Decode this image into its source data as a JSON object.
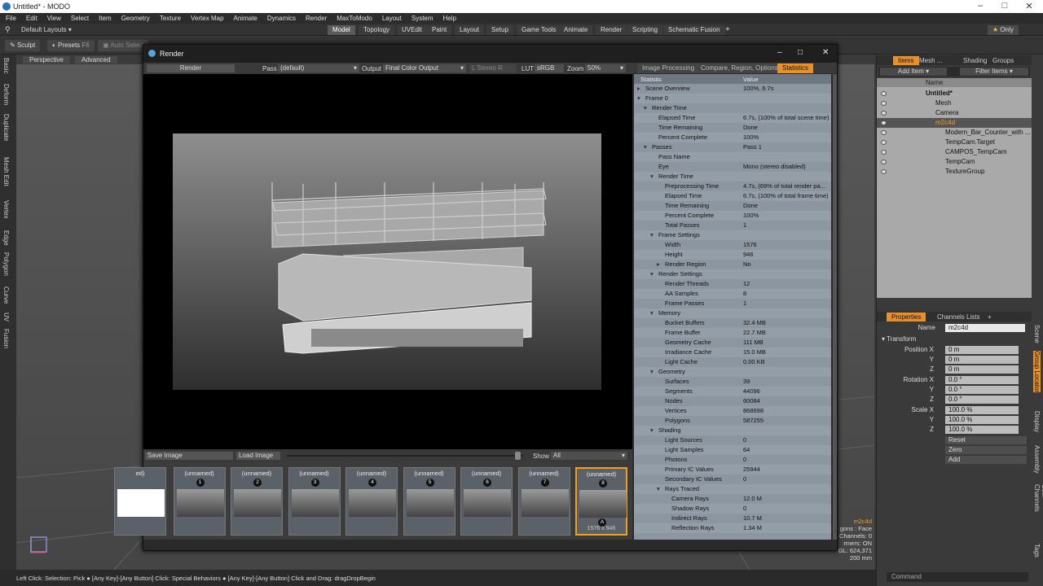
{
  "app": {
    "title": "Untitled* - MODO"
  },
  "menu": [
    "File",
    "Edit",
    "View",
    "Select",
    "Item",
    "Geometry",
    "Texture",
    "Vertex Map",
    "Animate",
    "Dynamics",
    "Render",
    "MaxToModo",
    "Layout",
    "System",
    "Help"
  ],
  "layouts": {
    "label": "Default Layouts",
    "tabs": [
      "Model",
      "Topology",
      "UVEdit",
      "Paint",
      "Layout",
      "Setup",
      "Game Tools",
      "Animate",
      "Render",
      "Scripting",
      "Schematic Fusion"
    ],
    "plus": "+",
    "only": "Only"
  },
  "toolbar": {
    "sculpt": "Sculpt",
    "presets": "Presets",
    "presets_key": "F6",
    "auto_select": "Auto Select"
  },
  "leftstrip": [
    "Basic",
    "Deform",
    "Duplicate",
    "Mesh Edit",
    "Vertex",
    "Edge",
    "Polygon",
    "Curve",
    "UV",
    "Fusion"
  ],
  "viewport": {
    "perspective": "Perspective",
    "advanced": "Advanced"
  },
  "status": "Left Click: Selection: Pick ● [Any Key]-[Any Button] Click: Special Behaviors ● [Any Key]-[Any Button] Click and Drag: dragDropBegin",
  "info": {
    "name": "m2c4d",
    "line1": "gons : Face",
    "line2": "Channels: 0",
    "line3": "rmers: ON",
    "line4": "GL: 624,371",
    "line5": "200 mm"
  },
  "render": {
    "title": "Render",
    "render_btn": "Render",
    "pass_label": "Pass",
    "pass_value": "(default)",
    "output_label": "Output",
    "output_value": "Final Color Output",
    "stereo": "Stereo",
    "stereo_key": "R",
    "lut_label": "LUT",
    "lut_value": "sRGB",
    "zoom_label": "Zoom",
    "zoom_value": "50%",
    "save_image": "Save Image",
    "load_image": "Load Image",
    "show_label": "Show",
    "show_value": "All",
    "tabs": [
      "Image Processing",
      "Compare, Region, Options",
      "Statistics"
    ],
    "thumbs": [
      {
        "label": "ed)",
        "num": ""
      },
      {
        "label": "(unnamed)",
        "num": "1"
      },
      {
        "label": "(unnamed)",
        "num": "2"
      },
      {
        "label": "(unnamed)",
        "num": "3"
      },
      {
        "label": "(unnamed)",
        "num": "4"
      },
      {
        "label": "(unnamed)",
        "num": "5"
      },
      {
        "label": "(unnamed)",
        "num": "6"
      },
      {
        "label": "(unnamed)",
        "num": "7"
      },
      {
        "label": "(unnamed)",
        "num": "8",
        "size": "1576 x 946",
        "marker": "A"
      }
    ],
    "stats_head": {
      "k": "Statistic",
      "v": "Value"
    },
    "stats": [
      {
        "k": "Scene Overview",
        "v": "100%, 6.7s",
        "d": 0,
        "a": "▸"
      },
      {
        "k": "Frame 0",
        "v": "",
        "d": 0,
        "a": "▾"
      },
      {
        "k": "Render Time",
        "v": "",
        "d": 1,
        "a": "▾"
      },
      {
        "k": "Elapsed Time",
        "v": "6.7s, (100% of total scene time)",
        "d": 2,
        "a": ""
      },
      {
        "k": "Time Remaining",
        "v": "Done",
        "d": 2,
        "a": ""
      },
      {
        "k": "Percent Complete",
        "v": "100%",
        "d": 2,
        "a": ""
      },
      {
        "k": "Passes",
        "v": "Pass 1",
        "d": 1,
        "a": "▾"
      },
      {
        "k": "Pass Name",
        "v": "",
        "d": 2,
        "a": ""
      },
      {
        "k": "Eye",
        "v": "Mono (stereo disabled)",
        "d": 2,
        "a": ""
      },
      {
        "k": "Render Time",
        "v": "",
        "d": 2,
        "a": "▾"
      },
      {
        "k": "Preprocessing Time",
        "v": "4.7s, (69% of total render pa...",
        "d": 3,
        "a": ""
      },
      {
        "k": "Elapsed Time",
        "v": "6.7s, (100% of total frame time)",
        "d": 3,
        "a": ""
      },
      {
        "k": "Time Remaining",
        "v": "Done",
        "d": 3,
        "a": ""
      },
      {
        "k": "Percent Complete",
        "v": "100%",
        "d": 3,
        "a": ""
      },
      {
        "k": "Total Passes",
        "v": "1",
        "d": 3,
        "a": ""
      },
      {
        "k": "Frame Settings",
        "v": "",
        "d": 2,
        "a": "▾"
      },
      {
        "k": "Width",
        "v": "1576",
        "d": 3,
        "a": ""
      },
      {
        "k": "Height",
        "v": "946",
        "d": 3,
        "a": ""
      },
      {
        "k": "Render Region",
        "v": "No",
        "d": 3,
        "a": "▸"
      },
      {
        "k": "Render Settings",
        "v": "",
        "d": 2,
        "a": "▾"
      },
      {
        "k": "Render Threads",
        "v": "12",
        "d": 3,
        "a": ""
      },
      {
        "k": "AA Samples",
        "v": "8",
        "d": 3,
        "a": ""
      },
      {
        "k": "Frame Passes",
        "v": "1",
        "d": 3,
        "a": ""
      },
      {
        "k": "Memory",
        "v": "",
        "d": 2,
        "a": "▾"
      },
      {
        "k": "Bucket Buffers",
        "v": "32.4 MB",
        "d": 3,
        "a": ""
      },
      {
        "k": "Frame Buffer",
        "v": "22.7 MB",
        "d": 3,
        "a": ""
      },
      {
        "k": "Geometry Cache",
        "v": "111 MB",
        "d": 3,
        "a": ""
      },
      {
        "k": "Irradiance Cache",
        "v": "15.0 MB",
        "d": 3,
        "a": ""
      },
      {
        "k": "Light Cache",
        "v": "0.00 KB",
        "d": 3,
        "a": ""
      },
      {
        "k": "Geometry",
        "v": "",
        "d": 2,
        "a": "▾"
      },
      {
        "k": "Surfaces",
        "v": "39",
        "d": 3,
        "a": ""
      },
      {
        "k": "Segments",
        "v": "44096",
        "d": 3,
        "a": ""
      },
      {
        "k": "Nodes",
        "v": "60084",
        "d": 3,
        "a": ""
      },
      {
        "k": "Vertices",
        "v": "868698",
        "d": 3,
        "a": ""
      },
      {
        "k": "Polygons",
        "v": "587255",
        "d": 3,
        "a": ""
      },
      {
        "k": "Shading",
        "v": "",
        "d": 2,
        "a": "▾"
      },
      {
        "k": "Light Sources",
        "v": "0",
        "d": 3,
        "a": ""
      },
      {
        "k": "Light Samples",
        "v": "64",
        "d": 3,
        "a": ""
      },
      {
        "k": "Photons",
        "v": "0",
        "d": 3,
        "a": ""
      },
      {
        "k": "Primary IC Values",
        "v": "25944",
        "d": 3,
        "a": ""
      },
      {
        "k": "Secondary IC Values",
        "v": "0",
        "d": 3,
        "a": ""
      },
      {
        "k": "Rays Traced",
        "v": "",
        "d": 3,
        "a": "▾"
      },
      {
        "k": "Camera Rays",
        "v": "12.0 M",
        "d": 4,
        "a": ""
      },
      {
        "k": "Shadow Rays",
        "v": "0",
        "d": 4,
        "a": ""
      },
      {
        "k": "Indirect Rays",
        "v": "10.7 M",
        "d": 4,
        "a": ""
      },
      {
        "k": "Reflection Rays",
        "v": "1.34 M",
        "d": 4,
        "a": ""
      }
    ]
  },
  "items": {
    "tabs": [
      "Items",
      "Mesh ...",
      "Shading",
      "Groups"
    ],
    "add_item": "Add Item",
    "filter_items": "Filter Items",
    "name_col": "Name",
    "tree": [
      {
        "label": "Untitled*",
        "d": 0
      },
      {
        "label": "Mesh",
        "d": 1
      },
      {
        "label": "Camera",
        "d": 1
      },
      {
        "label": "m2c4d",
        "d": 1
      },
      {
        "label": "Modern_Bar_Counter_with ...",
        "d": 2
      },
      {
        "label": "TempCam.Target",
        "d": 2
      },
      {
        "label": "CAMPOS_TempCam",
        "d": 2
      },
      {
        "label": "TempCam",
        "d": 2
      },
      {
        "label": "TextureGroup",
        "d": 2
      }
    ]
  },
  "props": {
    "tabs": [
      "Properties",
      "Channels",
      "Lists",
      "+"
    ],
    "name_label": "Name",
    "name_value": "m2c4d",
    "transform": "Transform",
    "rows": [
      {
        "l": "Position X",
        "v": "0 m"
      },
      {
        "l": "Y",
        "v": "0 m"
      },
      {
        "l": "Z",
        "v": "0 m"
      },
      {
        "l": "Rotation X",
        "v": "0.0 °"
      },
      {
        "l": "Y",
        "v": "0.0 °"
      },
      {
        "l": "Z",
        "v": "0.0 °"
      },
      {
        "l": "Scale X",
        "v": "100.0 %"
      },
      {
        "l": "Y",
        "v": "100.0 %"
      },
      {
        "l": "Z",
        "v": "100.0 %"
      }
    ],
    "reset": "Reset",
    "zero": "Zero",
    "add": "Add",
    "side": [
      "Scene",
      "Group Locator",
      "Display",
      "Assembly",
      "User Channels",
      "Tags"
    ],
    "command": "Command"
  }
}
